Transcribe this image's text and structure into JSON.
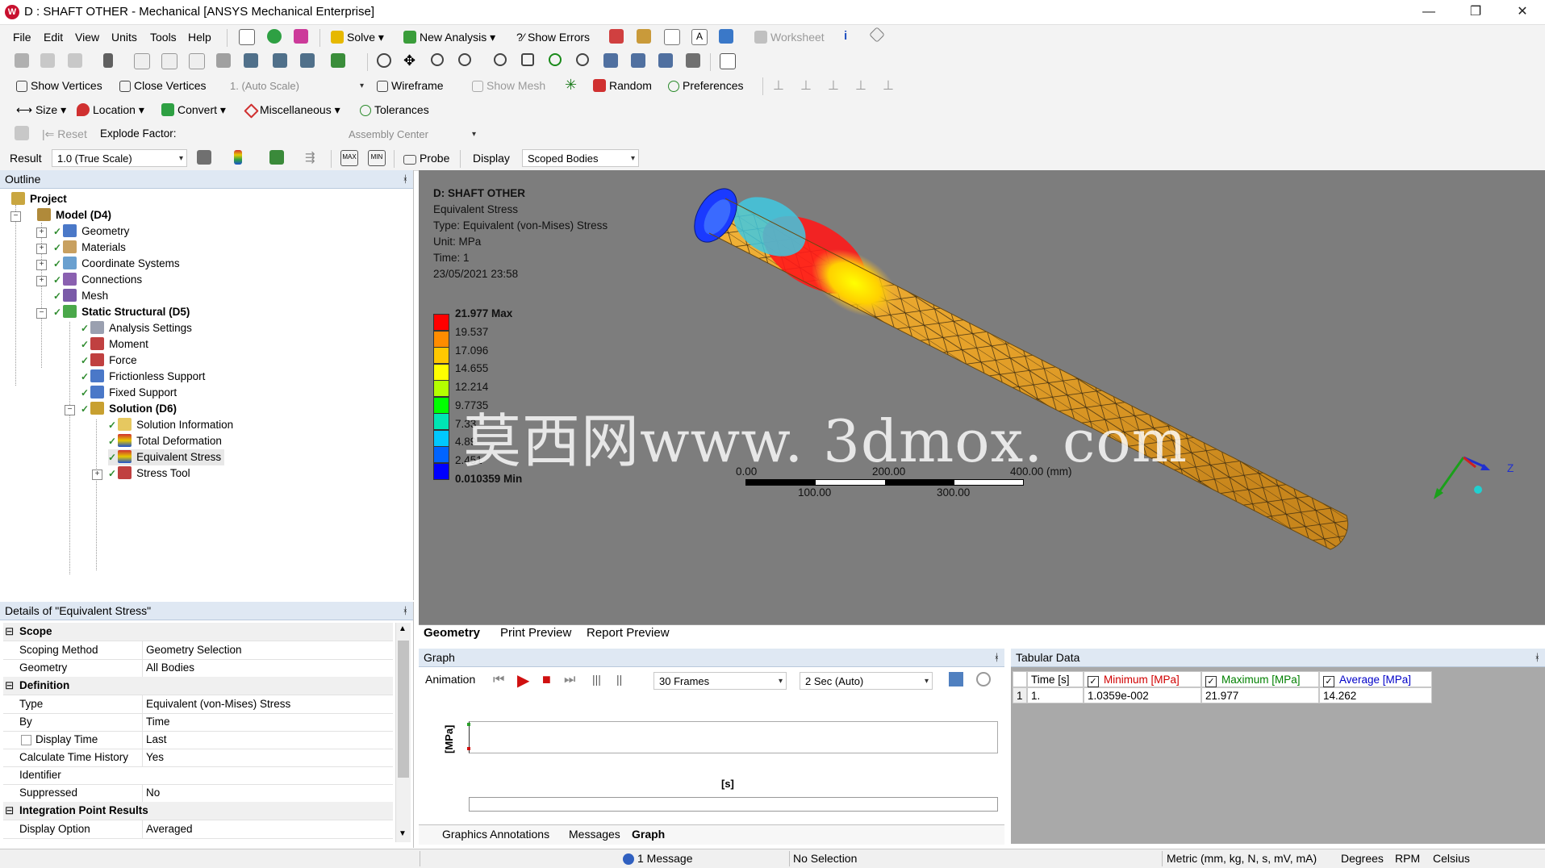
{
  "window": {
    "title": "D : SHAFT OTHER - Mechanical [ANSYS Mechanical Enterprise]",
    "logo": "W",
    "minimize": "—",
    "restore": "❐",
    "close": "✕"
  },
  "menu": [
    "File",
    "Edit",
    "View",
    "Units",
    "Tools",
    "Help"
  ],
  "toolbar1": {
    "solve": "Solve",
    "new_analysis": "New Analysis",
    "show_errors": "Show Errors",
    "worksheet": "Worksheet"
  },
  "toolbar3": {
    "show_vertices": "Show Vertices",
    "close_vertices": "Close Vertices",
    "scale": "1. (Auto Scale)",
    "wireframe": "Wireframe",
    "show_mesh": "Show Mesh",
    "random": "Random",
    "preferences": "Preferences"
  },
  "toolbar4": {
    "size": "Size",
    "location": "Location",
    "convert": "Convert",
    "miscellaneous": "Miscellaneous",
    "tolerances": "Tolerances"
  },
  "toolbar5": {
    "reset": "Reset",
    "explode_factor": "Explode Factor:",
    "assembly_center": "Assembly Center"
  },
  "toolbar6": {
    "result": "Result",
    "scale_value": "1.0 (True Scale)",
    "probe": "Probe",
    "display": "Display",
    "scoped_bodies": "Scoped Bodies"
  },
  "outline": {
    "header": "Outline",
    "pin": "ᚼ",
    "items": [
      {
        "label": "Project",
        "icon": "project-icon"
      },
      {
        "label": "Model (D4)",
        "icon": "model-icon"
      },
      {
        "label": "Geometry",
        "icon": "geometry-icon"
      },
      {
        "label": "Materials",
        "icon": "materials-icon"
      },
      {
        "label": "Coordinate Systems",
        "icon": "coordinate-systems-icon"
      },
      {
        "label": "Connections",
        "icon": "connections-icon"
      },
      {
        "label": "Mesh",
        "icon": "mesh-icon"
      },
      {
        "label": "Static Structural (D5)",
        "icon": "static-structural-icon"
      },
      {
        "label": "Analysis Settings",
        "icon": "analysis-settings-icon"
      },
      {
        "label": "Moment",
        "icon": "moment-icon"
      },
      {
        "label": "Force",
        "icon": "force-icon"
      },
      {
        "label": "Frictionless Support",
        "icon": "frictionless-support-icon"
      },
      {
        "label": "Fixed Support",
        "icon": "fixed-support-icon"
      },
      {
        "label": "Solution (D6)",
        "icon": "solution-icon"
      },
      {
        "label": "Solution Information",
        "icon": "solution-information-icon"
      },
      {
        "label": "Total Deformation",
        "icon": "total-deformation-icon"
      },
      {
        "label": "Equivalent Stress",
        "icon": "equivalent-stress-icon"
      },
      {
        "label": "Stress Tool",
        "icon": "stress-tool-icon"
      }
    ]
  },
  "details": {
    "header": "Details of \"Equivalent Stress\"",
    "sections": {
      "scope": "Scope",
      "definition": "Definition",
      "integration": "Integration Point Results"
    },
    "rows": {
      "scoping_method": {
        "k": "Scoping Method",
        "v": "Geometry Selection"
      },
      "geometry": {
        "k": "Geometry",
        "v": "All Bodies"
      },
      "type": {
        "k": "Type",
        "v": "Equivalent (von-Mises) Stress"
      },
      "by": {
        "k": "By",
        "v": "Time"
      },
      "display_time": {
        "k": "Display Time",
        "v": "Last"
      },
      "calc_time_history": {
        "k": "Calculate Time History",
        "v": "Yes"
      },
      "identifier": {
        "k": "Identifier",
        "v": ""
      },
      "suppressed": {
        "k": "Suppressed",
        "v": "No"
      },
      "display_option": {
        "k": "Display Option",
        "v": "Averaged"
      }
    }
  },
  "viewport": {
    "title": "D: SHAFT OTHER",
    "result_name": "Equivalent Stress",
    "type": "Type: Equivalent (von-Mises) Stress",
    "unit": "Unit: MPa",
    "time": "Time: 1",
    "date": "23/05/2021 23:58",
    "legend": {
      "max": "21.977 Max",
      "min": "0.010359 Min",
      "values": [
        "19.537",
        "17.096",
        "14.655",
        "12.214",
        "9.7735",
        "7.33",
        "4.89",
        "2.451"
      ],
      "colors": [
        "#ff0000",
        "#ff8c00",
        "#ffc800",
        "#ffff00",
        "#b4ff00",
        "#00ff00",
        "#00e6b4",
        "#00c8ff",
        "#0064ff",
        "#0000ff"
      ]
    },
    "scale": {
      "top": [
        "0.00",
        "200.00",
        "400.00 (mm)"
      ],
      "bottom": [
        "100.00",
        "300.00"
      ]
    },
    "triad_axis": "Z",
    "watermark": "莫西网www. 3dmox. com"
  },
  "tabs": [
    "Geometry",
    "Print Preview",
    "Report Preview"
  ],
  "graph": {
    "header": "Graph",
    "animation": "Animation",
    "frames": "30 Frames",
    "speed": "2 Sec (Auto)",
    "ylabel": "[MPa]",
    "xlabel": "[s]",
    "bottom_tabs": [
      "Graphics Annotations",
      "Messages",
      "Graph"
    ]
  },
  "tabular": {
    "header": "Tabular Data",
    "columns": [
      "Time [s]",
      "Minimum [MPa]",
      "Maximum [MPa]",
      "Average [MPa]"
    ],
    "column_colors": [
      "#000000",
      "#d00000",
      "#008000",
      "#0000c8"
    ],
    "rows": [
      {
        "index": "1",
        "time": "1.",
        "min": "1.0359e-002",
        "max": "21.977",
        "avg": "14.262"
      }
    ]
  },
  "status": {
    "message": "1 Message",
    "selection": "No Selection",
    "units": "Metric (mm, kg, N, s, mV, mA)",
    "degrees": "Degrees",
    "rpm": "RPM",
    "temp": "Celsius"
  }
}
